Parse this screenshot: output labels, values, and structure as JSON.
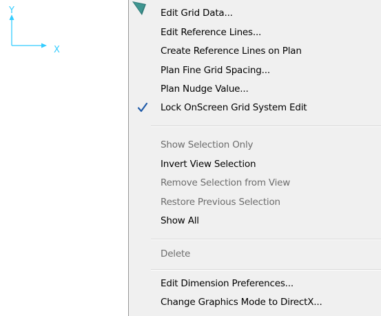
{
  "axis": {
    "y_label": "Y",
    "x_label": "X",
    "color": "#33ccff"
  },
  "menu": {
    "items": [
      {
        "label": "Edit Grid Data...",
        "enabled": true
      },
      {
        "label": "Edit Reference Lines...",
        "enabled": true
      },
      {
        "label": "Create Reference Lines on Plan",
        "enabled": true
      },
      {
        "label": "Plan Fine Grid Spacing...",
        "enabled": true
      },
      {
        "label": "Plan Nudge Value...",
        "enabled": true
      },
      {
        "label": "Lock OnScreen Grid System Edit",
        "enabled": true,
        "checked": true
      },
      {
        "label": "Show Selection Only",
        "enabled": false
      },
      {
        "label": "Invert View Selection",
        "enabled": true
      },
      {
        "label": "Remove Selection from View",
        "enabled": false
      },
      {
        "label": "Restore Previous Selection",
        "enabled": false
      },
      {
        "label": "Show All",
        "enabled": true
      },
      {
        "label": "Delete",
        "enabled": false
      },
      {
        "label": "Edit Dimension Preferences...",
        "enabled": true
      },
      {
        "label": "Change Graphics Mode to DirectX...",
        "enabled": true
      }
    ]
  },
  "icons": {
    "check": "check-icon",
    "cursor": "cursor-arrow-icon"
  },
  "colors": {
    "check": "#1e5aa8",
    "disabled_text": "#6d6d6d",
    "menu_bg": "#f0f0f0"
  }
}
